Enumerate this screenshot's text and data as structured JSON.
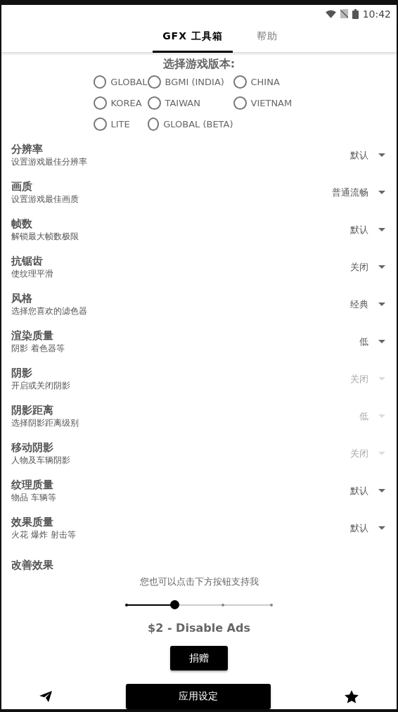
{
  "status_bar": {
    "time": "10:42"
  },
  "tabs": [
    {
      "label": "GFX 工具箱",
      "selected": true
    },
    {
      "label": "帮助",
      "selected": false
    }
  ],
  "version_picker": {
    "title": "选择游戏版本:",
    "options": [
      {
        "label": "GLOBAL",
        "selected": false
      },
      {
        "label": "BGMI (INDIA)",
        "selected": false
      },
      {
        "label": "CHINA",
        "selected": false
      },
      {
        "label": "KOREA",
        "selected": false
      },
      {
        "label": "TAIWAN",
        "selected": false
      },
      {
        "label": "VIETNAM",
        "selected": false
      },
      {
        "label": "LITE",
        "selected": false
      },
      {
        "label": "GLOBAL (BETA)",
        "selected": false
      }
    ]
  },
  "settings": [
    {
      "title": "分辨率",
      "description": "设置游戏最佳分辨率",
      "value": "默认",
      "disabled": false
    },
    {
      "title": "画质",
      "description": "设置游戏最佳画质",
      "value": "普通流畅",
      "disabled": false
    },
    {
      "title": "帧数",
      "description": "解锁最大帧数极限",
      "value": "默认",
      "disabled": false
    },
    {
      "title": "抗锯齿",
      "description": "使纹理平滑",
      "value": "关闭",
      "disabled": false
    },
    {
      "title": "风格",
      "description": "选择您喜欢的滤色器",
      "value": "经典",
      "disabled": false
    },
    {
      "title": "渲染质量",
      "description": "阴影 着色器等",
      "value": "低",
      "disabled": false
    },
    {
      "title": "阴影",
      "description": "开启或关闭阴影",
      "value": "关闭",
      "disabled": true
    },
    {
      "title": "阴影距离",
      "description": "选择阴影距离级别",
      "value": "低",
      "disabled": true
    },
    {
      "title": "移动阴影",
      "description": "人物及车辆阴影",
      "value": "关闭",
      "disabled": true
    },
    {
      "title": "纹理质量",
      "description": "物品 车辆等",
      "value": "默认",
      "disabled": false
    },
    {
      "title": "效果质量",
      "description": "火花 爆炸 射击等",
      "value": "默认",
      "disabled": false
    },
    {
      "title": "改善效果"
    }
  ],
  "support": {
    "message": "您也可以点击下方按钮支持我",
    "slider": {
      "level": 0.333
    },
    "price": "$2 - Disable Ads",
    "donate_button": "捐赠"
  },
  "bottom_bar": {
    "apply_button": "应用设定"
  }
}
